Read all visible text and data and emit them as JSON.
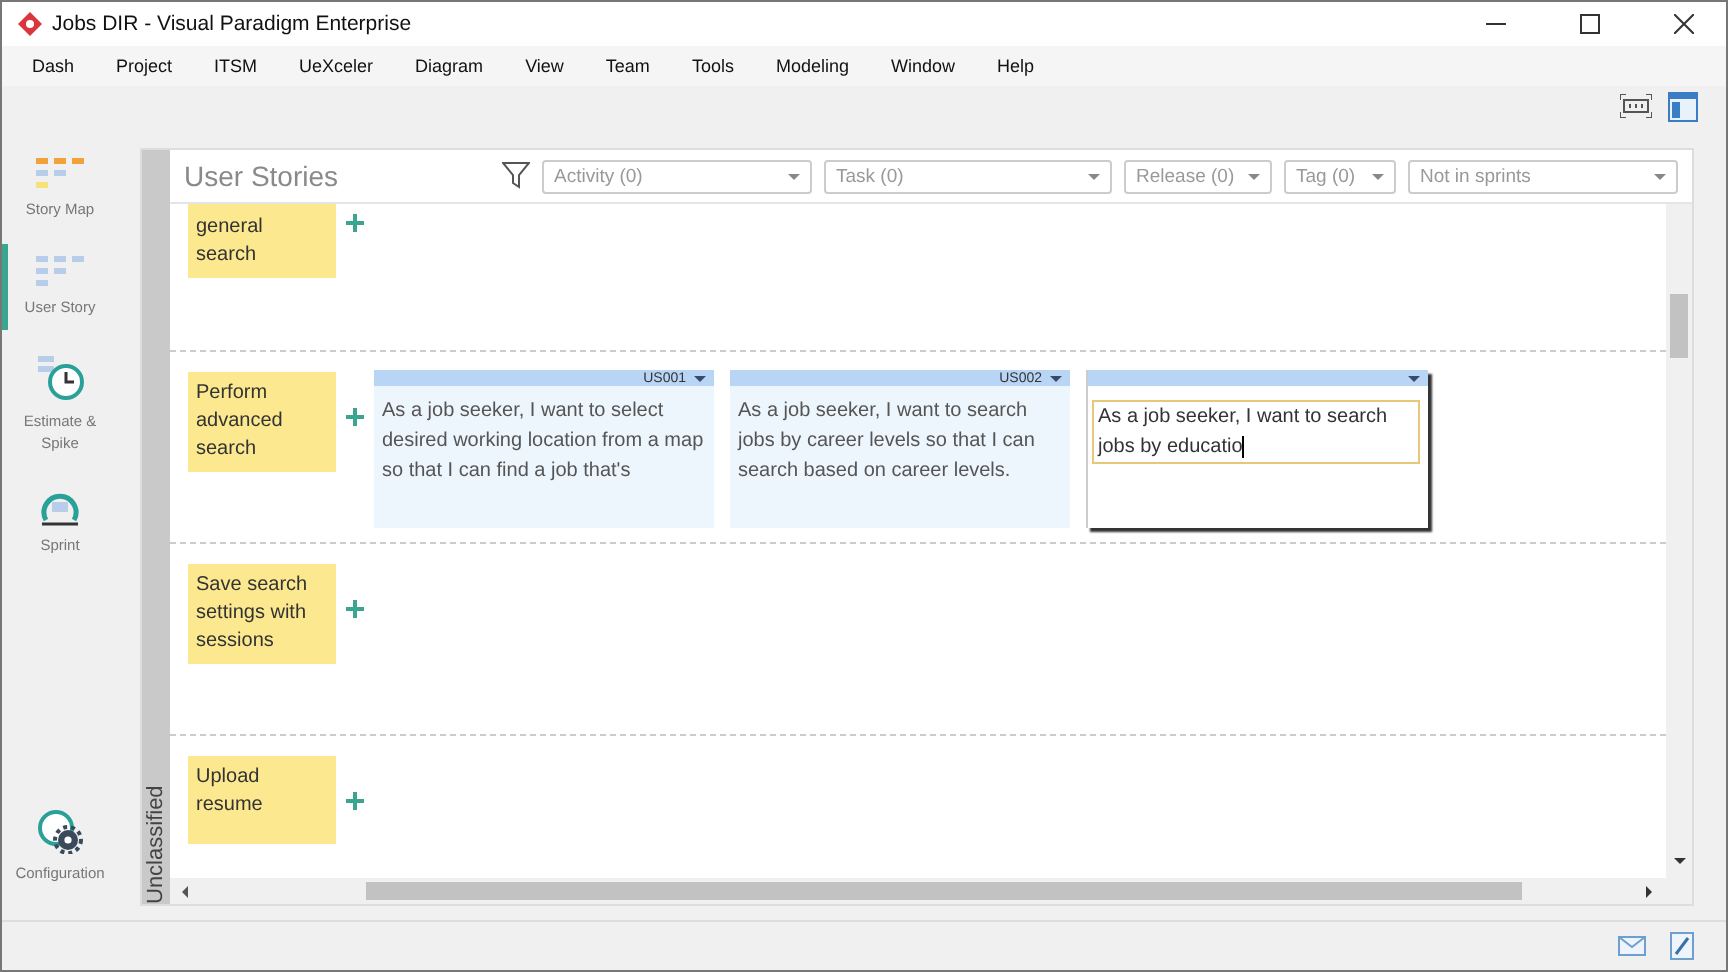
{
  "window": {
    "title": "Jobs DIR - Visual Paradigm Enterprise"
  },
  "menu": [
    "Dash",
    "Project",
    "ITSM",
    "UeXceler",
    "Diagram",
    "View",
    "Team",
    "Tools",
    "Modeling",
    "Window",
    "Help"
  ],
  "sidebar": {
    "items": [
      {
        "kind": "story-map",
        "label": "Story Map",
        "selected": false
      },
      {
        "kind": "user-story",
        "label": "User Story",
        "selected": true
      },
      {
        "kind": "estimate",
        "label": "Estimate & Spike",
        "selected": false
      },
      {
        "kind": "sprint",
        "label": "Sprint",
        "selected": false
      }
    ],
    "footer": {
      "label": "Configuration"
    }
  },
  "panel": {
    "side_label": "Unclassified",
    "title": "User Stories",
    "filters": [
      {
        "label": "Activity (0)"
      },
      {
        "label": "Task (0)"
      },
      {
        "label": "Release (0)"
      },
      {
        "label": "Tag (0)"
      },
      {
        "label": "Not in sprints"
      }
    ],
    "rows": [
      {
        "epic": "general search",
        "stories": []
      },
      {
        "epic": "Perform advanced search",
        "stories": [
          {
            "id": "US001",
            "text": "As a job seeker, I want to select desired working location from a map so that I can find a job that's",
            "editing": false
          },
          {
            "id": "US002",
            "text": "As a job seeker, I want to search jobs by career levels so that I can search based on career levels.",
            "editing": false
          },
          {
            "text": "As a job seeker, I want to search jobs by educatio",
            "editing": true
          }
        ]
      },
      {
        "epic": "Save search settings with sessions",
        "stories": []
      },
      {
        "epic": "Upload resume",
        "stories": []
      }
    ]
  }
}
